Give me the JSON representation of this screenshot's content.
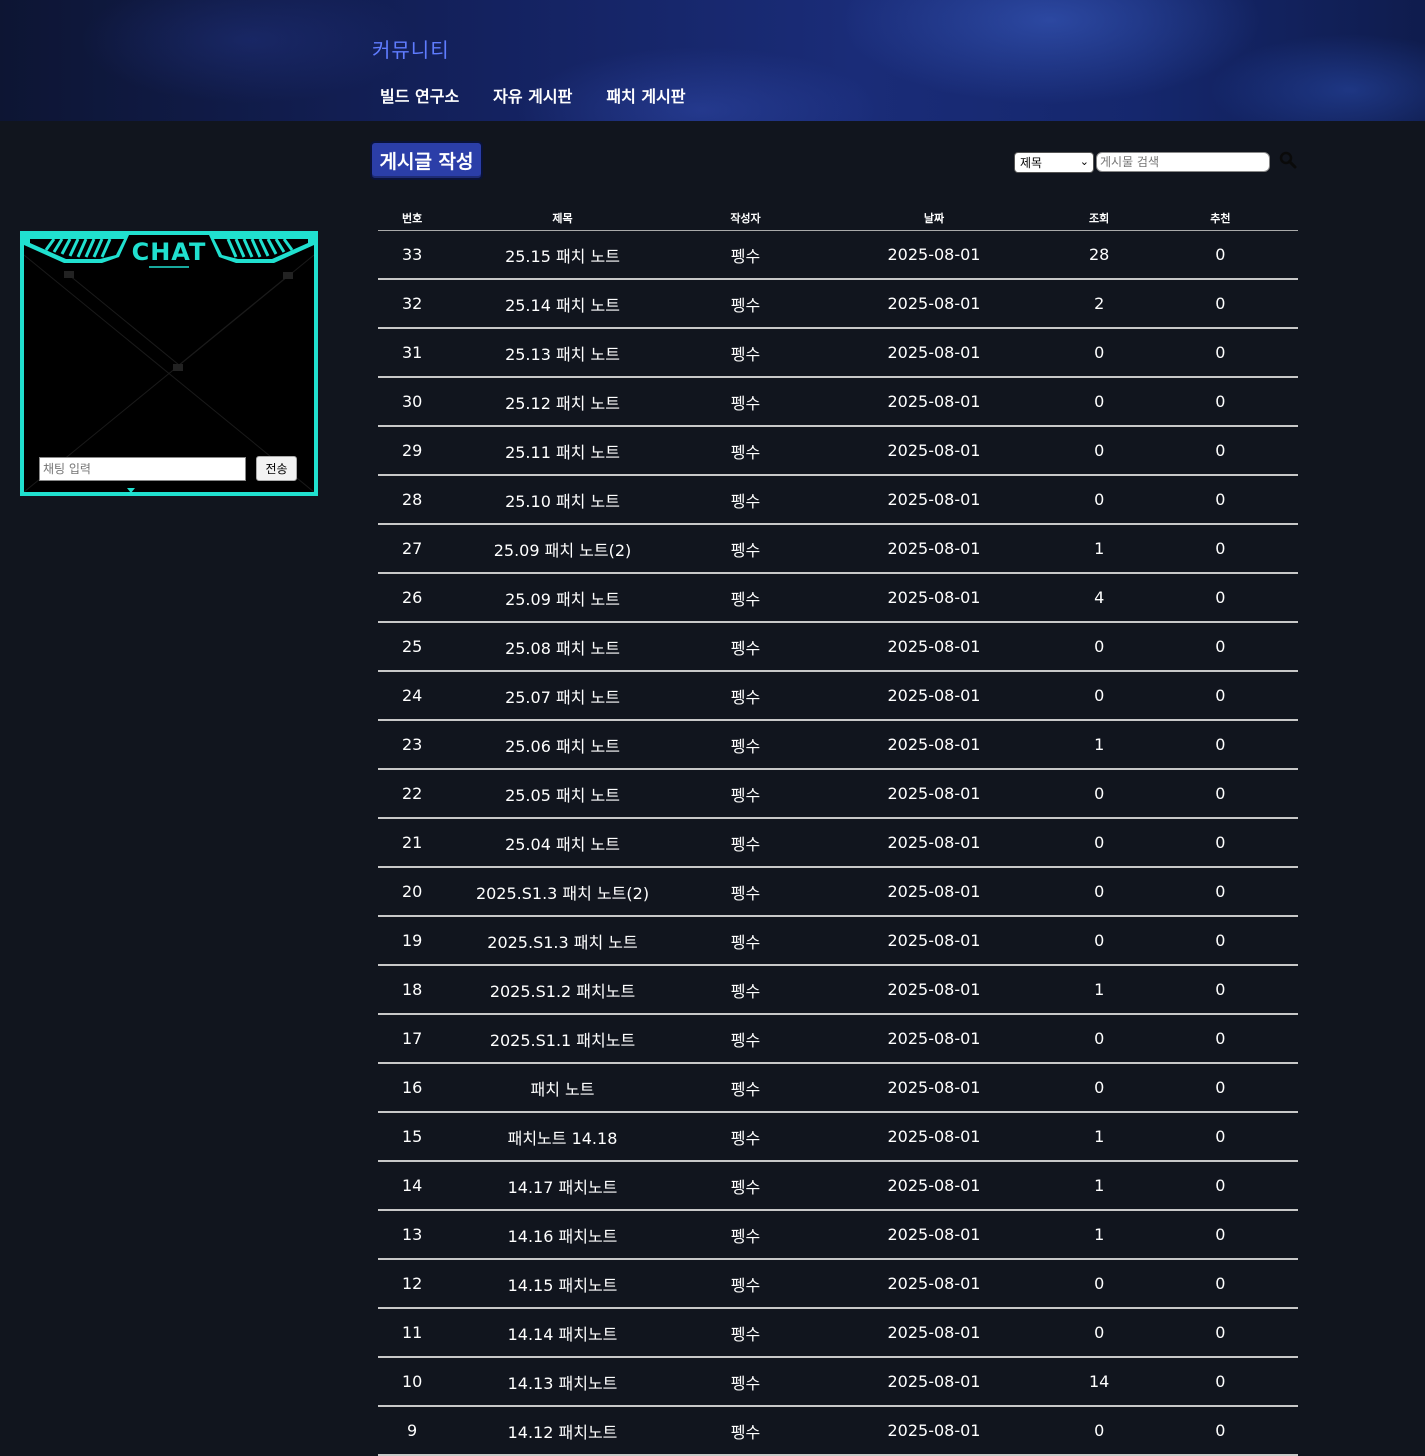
{
  "header": {
    "site_title": "커뮤니티",
    "nav": [
      "빌드 연구소",
      "자유 게시판",
      "패치 게시판"
    ]
  },
  "toolbar": {
    "write_label": "게시글 작성",
    "search_field_selected": "제목",
    "search_placeholder": "게시물 검색",
    "search_icon": "magnifier-icon"
  },
  "chat": {
    "title": "CHAT",
    "input_placeholder": "채팅 입력",
    "send_label": "전송",
    "accent_color": "#20e0cf"
  },
  "table": {
    "headers": [
      "번호",
      "제목",
      "작성자",
      "날짜",
      "조회",
      "추천"
    ],
    "rows": [
      [
        "33",
        "25.15 패치 노트",
        "펭수",
        "2025-08-01",
        "28",
        "0"
      ],
      [
        "32",
        "25.14 패치 노트",
        "펭수",
        "2025-08-01",
        "2",
        "0"
      ],
      [
        "31",
        "25.13 패치 노트",
        "펭수",
        "2025-08-01",
        "0",
        "0"
      ],
      [
        "30",
        "25.12 패치 노트",
        "펭수",
        "2025-08-01",
        "0",
        "0"
      ],
      [
        "29",
        "25.11 패치 노트",
        "펭수",
        "2025-08-01",
        "0",
        "0"
      ],
      [
        "28",
        "25.10 패치 노트",
        "펭수",
        "2025-08-01",
        "0",
        "0"
      ],
      [
        "27",
        "25.09 패치 노트(2)",
        "펭수",
        "2025-08-01",
        "1",
        "0"
      ],
      [
        "26",
        "25.09 패치 노트",
        "펭수",
        "2025-08-01",
        "4",
        "0"
      ],
      [
        "25",
        "25.08 패치 노트",
        "펭수",
        "2025-08-01",
        "0",
        "0"
      ],
      [
        "24",
        "25.07 패치 노트",
        "펭수",
        "2025-08-01",
        "0",
        "0"
      ],
      [
        "23",
        "25.06 패치 노트",
        "펭수",
        "2025-08-01",
        "1",
        "0"
      ],
      [
        "22",
        "25.05 패치 노트",
        "펭수",
        "2025-08-01",
        "0",
        "0"
      ],
      [
        "21",
        "25.04 패치 노트",
        "펭수",
        "2025-08-01",
        "0",
        "0"
      ],
      [
        "20",
        "2025.S1.3 패치 노트(2)",
        "펭수",
        "2025-08-01",
        "0",
        "0"
      ],
      [
        "19",
        "2025.S1.3 패치 노트",
        "펭수",
        "2025-08-01",
        "0",
        "0"
      ],
      [
        "18",
        "2025.S1.2 패치노트",
        "펭수",
        "2025-08-01",
        "1",
        "0"
      ],
      [
        "17",
        "2025.S1.1 패치노트",
        "펭수",
        "2025-08-01",
        "0",
        "0"
      ],
      [
        "16",
        "패치 노트",
        "펭수",
        "2025-08-01",
        "0",
        "0"
      ],
      [
        "15",
        "패치노트 14.18",
        "펭수",
        "2025-08-01",
        "1",
        "0"
      ],
      [
        "14",
        "14.17 패치노트",
        "펭수",
        "2025-08-01",
        "1",
        "0"
      ],
      [
        "13",
        "14.16 패치노트",
        "펭수",
        "2025-08-01",
        "1",
        "0"
      ],
      [
        "12",
        "14.15 패치노트",
        "펭수",
        "2025-08-01",
        "0",
        "0"
      ],
      [
        "11",
        "14.14 패치노트",
        "펭수",
        "2025-08-01",
        "0",
        "0"
      ],
      [
        "10",
        "14.13 패치노트",
        "펭수",
        "2025-08-01",
        "14",
        "0"
      ],
      [
        "9",
        "14.12 패치노트",
        "펭수",
        "2025-08-01",
        "0",
        "0"
      ]
    ]
  }
}
